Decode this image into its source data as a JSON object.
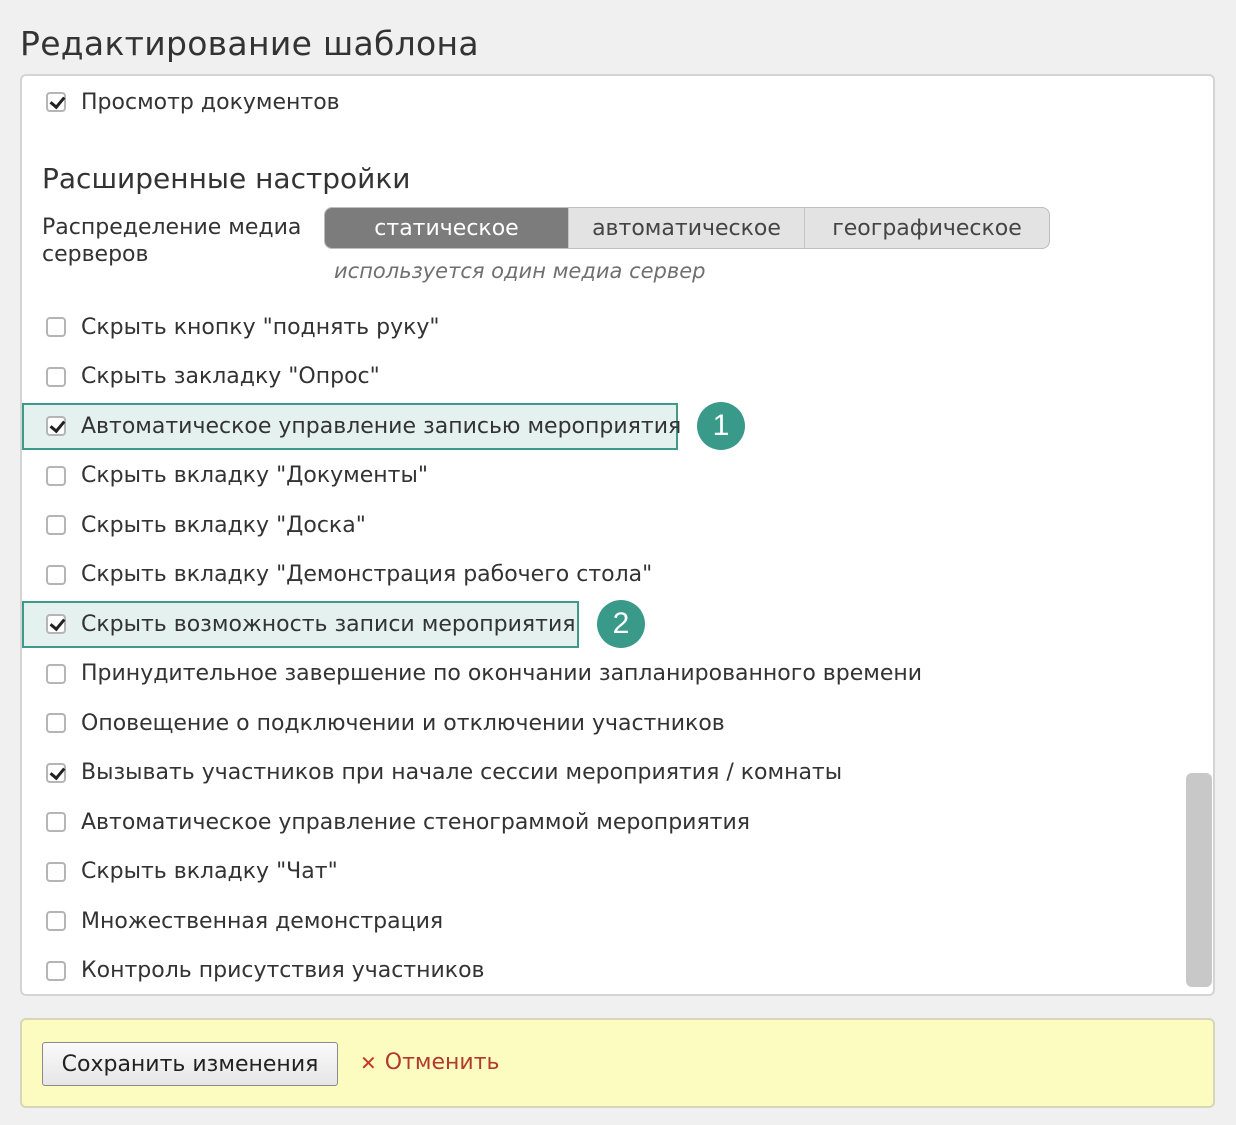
{
  "page": {
    "title": "Редактирование шаблона"
  },
  "settings": {
    "view_docs": {
      "label": "Просмотр документов",
      "checked": true
    },
    "advanced_title": "Расширенные настройки",
    "media_distribution": {
      "label": "Распределение медиа серверов",
      "options": [
        "статическое",
        "автоматическое",
        "географическое"
      ],
      "selected": "статическое",
      "hint": "используется один медиа сервер"
    },
    "items": [
      {
        "label": "Скрыть кнопку \"поднять руку\"",
        "checked": false
      },
      {
        "label": "Скрыть закладку \"Опрос\"",
        "checked": false
      },
      {
        "label": "Автоматическое управление записью мероприятия",
        "checked": true,
        "badge": "1"
      },
      {
        "label": "Скрыть вкладку \"Документы\"",
        "checked": false
      },
      {
        "label": "Скрыть вкладку \"Доска\"",
        "checked": false
      },
      {
        "label": "Скрыть вкладку \"Демонстрация рабочего стола\"",
        "checked": false
      },
      {
        "label": "Скрыть возможность записи мероприятия",
        "checked": true,
        "badge": "2"
      },
      {
        "label": "Принудительное завершение по окончании запланированного времени",
        "checked": false
      },
      {
        "label": "Оповещение о подключении и отключении участников",
        "checked": false
      },
      {
        "label": "Вызывать участников при начале сессии мероприятия / комнаты",
        "checked": true
      },
      {
        "label": "Автоматическое управление стенограммой мероприятия",
        "checked": false
      },
      {
        "label": "Скрыть вкладку \"Чат\"",
        "checked": false
      },
      {
        "label": "Множественная демонстрация",
        "checked": false
      },
      {
        "label": "Контроль присутствия участников",
        "checked": false
      }
    ]
  },
  "footer": {
    "save_label": "Сохранить изменения",
    "cancel_label": "Отменить"
  },
  "colors": {
    "highlight_border": "#3f9a8c",
    "badge": "#3a9a8a",
    "footer_bg": "#fdfcc0",
    "cancel": "#b23a2a"
  }
}
